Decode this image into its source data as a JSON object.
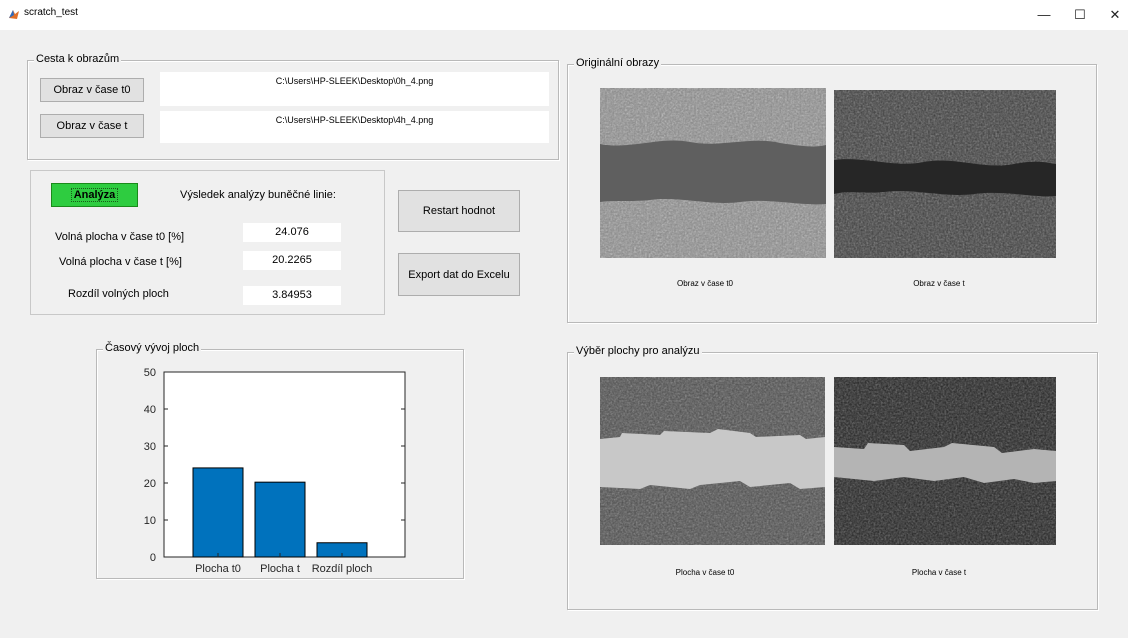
{
  "window": {
    "title": "scratch_test",
    "minimize_glyph": "—",
    "maximize_glyph": "☐",
    "close_glyph": "✕"
  },
  "paths_panel": {
    "title": "Cesta k obrazům",
    "btn_t0": "Obraz v čase t0",
    "btn_t": "Obraz v čase t",
    "path_t0": "C:\\Users\\HP-SLEEK\\Desktop\\0h_4.png",
    "path_t": "C:\\Users\\HP-SLEEK\\Desktop\\4h_4.png"
  },
  "analysis_panel": {
    "analyze_button": "Analýza",
    "result_heading": "Výsledek analýzy buněčné linie:",
    "row1_label": "Volná plocha v čase t0 [%]",
    "row1_value": "24.076",
    "row2_label": "Volná plocha v čase t [%]",
    "row2_value": "20.2265",
    "row3_label": "Rozdíl volných ploch",
    "row3_value": "3.84953"
  },
  "actions": {
    "restart": "Restart hodnot",
    "export": "Export dat do Excelu"
  },
  "original_panel": {
    "title": "Originální obrazy",
    "caption_t0": "Obraz v čase t0",
    "caption_t": "Obraz v čase t"
  },
  "selection_panel": {
    "title": "Výběr plochy pro analýzu",
    "caption_t0": "Plocha v čase t0",
    "caption_t": "Plocha v čase t"
  },
  "chart_panel": {
    "title": "Časový vývoj ploch"
  },
  "chart_data": {
    "type": "bar",
    "categories": [
      "Plocha t0",
      "Plocha t",
      "Rozdíl ploch"
    ],
    "values": [
      24.076,
      20.2265,
      3.84953
    ],
    "ylim": [
      0,
      50
    ],
    "yticks": [
      0,
      10,
      20,
      30,
      40,
      50
    ],
    "bar_color": "#0072bd",
    "grid": false
  }
}
